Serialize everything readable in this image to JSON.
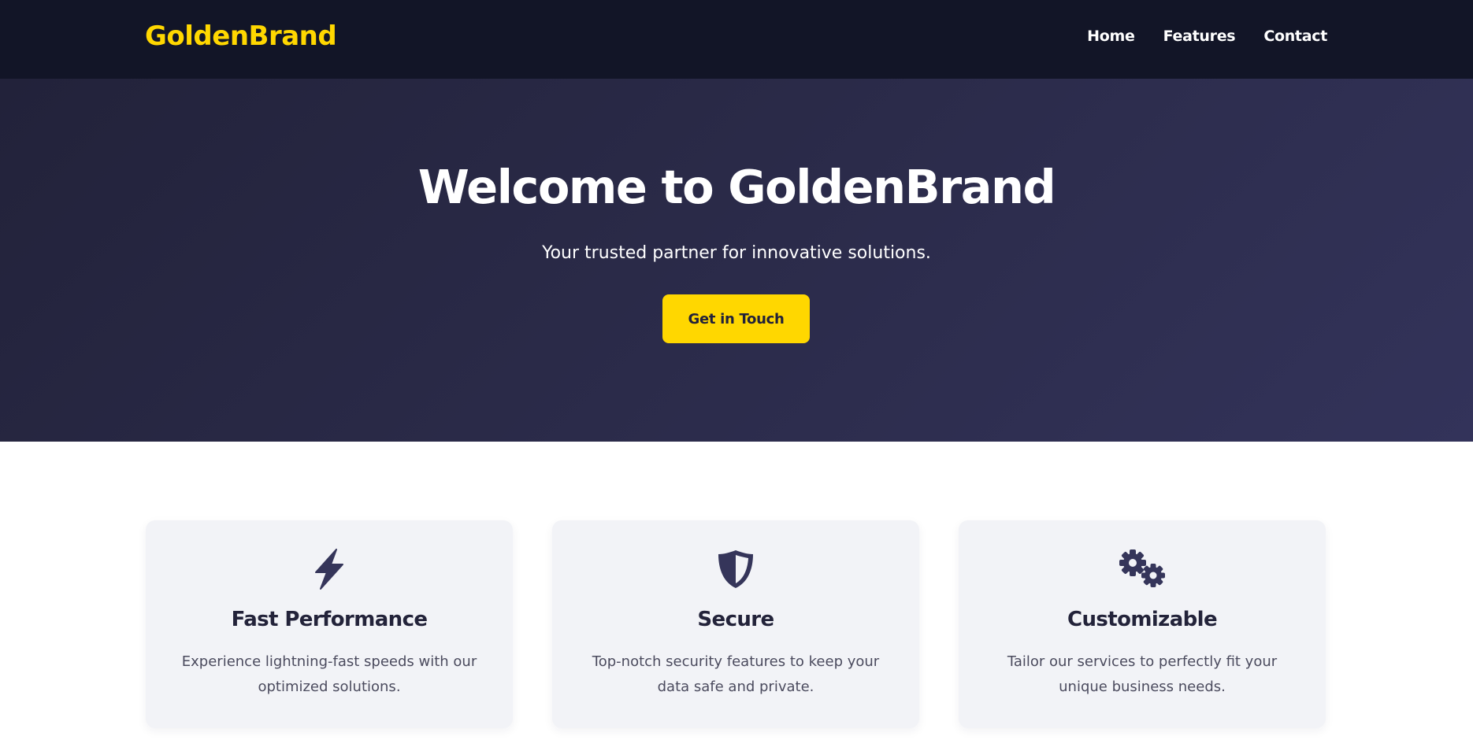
{
  "header": {
    "logo": "GoldenBrand",
    "nav": [
      {
        "label": "Home"
      },
      {
        "label": "Features"
      },
      {
        "label": "Contact"
      }
    ]
  },
  "hero": {
    "title": "Welcome to GoldenBrand",
    "subtitle": "Your trusted partner for innovative solutions.",
    "cta_label": "Get in Touch"
  },
  "features": [
    {
      "icon": "lightning-bolt-icon",
      "title": "Fast Performance",
      "description": "Experience lightning-fast speeds with our optimized solutions."
    },
    {
      "icon": "shield-icon",
      "title": "Secure",
      "description": "Top-notch security features to keep your data safe and private."
    },
    {
      "icon": "gears-icon",
      "title": "Customizable",
      "description": "Tailor our services to perfectly fit your unique business needs."
    }
  ],
  "colors": {
    "brand_gold": "#ffd700",
    "header_bg": "#121527",
    "hero_bg_start": "#22223a",
    "hero_bg_end": "#33335a",
    "icon_color": "#35355a",
    "card_bg": "#f2f3f7"
  }
}
